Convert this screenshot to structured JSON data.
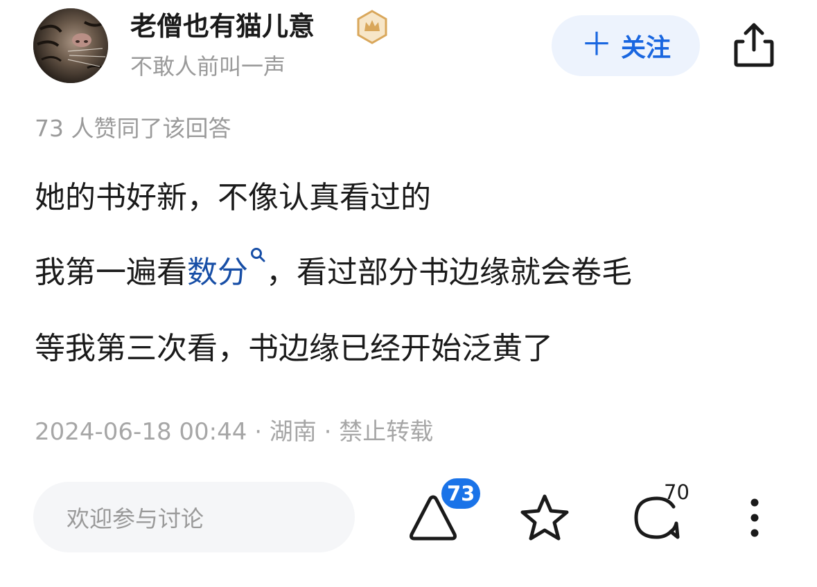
{
  "author": {
    "name": "老僧也有猫儿意",
    "bio": "不敢人前叫一声",
    "avatar_icon": "tiger-avatar",
    "badge_icon": "crown-badge-icon"
  },
  "header": {
    "follow_plus": "＋",
    "follow_label": "关注",
    "share_icon": "share-icon"
  },
  "answer": {
    "like_summary": "73 人赞同了该回答",
    "line1": "她的书好新，不像认真看过的",
    "line2_before": "我第一遍看",
    "line2_link": "数分",
    "line2_after": "，看过部分书边缘就会卷毛",
    "line3": "等我第三次看，书边缘已经开始泛黄了",
    "meta": "2024-06-18 00:44 · 湖南 · 禁止转载"
  },
  "bottom_bar": {
    "comment_placeholder": "欢迎参与讨论",
    "upvote_count": "73",
    "comment_count": "70",
    "icons": [
      "upvote-icon",
      "star-icon",
      "comment-icon",
      "more-icon"
    ]
  },
  "colors": {
    "accent": "#1966e0",
    "follow_bg": "#edf3fd",
    "link": "#174ea6",
    "badge_bg": "#1a73e8",
    "muted_text": "#9a9a9a",
    "crown_gold": "#d9a75b"
  }
}
